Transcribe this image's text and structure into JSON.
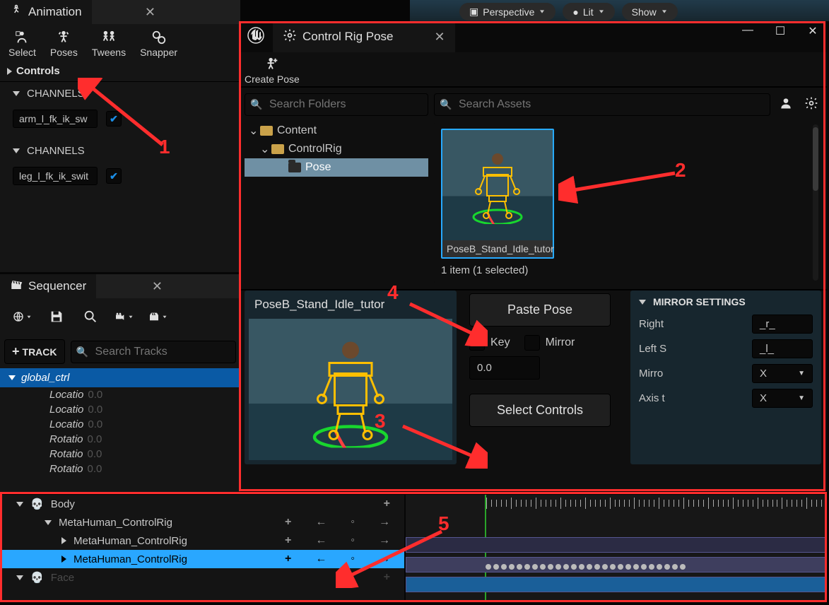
{
  "animation": {
    "title": "Animation",
    "tools": {
      "select": "Select",
      "poses": "Poses",
      "tweens": "Tweens",
      "snapper": "Snapper"
    },
    "controls_section": "Controls",
    "channels_label": "CHANNELS",
    "channel1_name": "arm_l_fk_ik_sw",
    "channel2_name": "leg_l_fk_ik_swit"
  },
  "sequencer": {
    "title": "Sequencer",
    "add_track": "TRACK",
    "search_placeholder": "Search Tracks",
    "global_ctrl": "global_ctrl",
    "props": [
      {
        "label": "Locatio",
        "value": "0.0"
      },
      {
        "label": "Locatio",
        "value": "0.0"
      },
      {
        "label": "Locatio",
        "value": "0.0"
      },
      {
        "label": "Rotatio",
        "value": "0.0"
      },
      {
        "label": "Rotatio",
        "value": "0.0"
      },
      {
        "label": "Rotatio",
        "value": "0.0"
      }
    ],
    "body_track": "Body",
    "rig_tracks": [
      "MetaHuman_ControlRig",
      "MetaHuman_ControlRig",
      "MetaHuman_ControlRig"
    ],
    "last_track_partial": "Face"
  },
  "viewport": {
    "perspective": "Perspective",
    "lit": "Lit",
    "show": "Show"
  },
  "control_rig_pose": {
    "title": "Control Rig Pose",
    "create_pose": "Create Pose",
    "search_folders_ph": "Search Folders",
    "search_assets_ph": "Search Assets",
    "tree": {
      "content": "Content",
      "control_rig": "ControlRig",
      "pose": "Pose"
    },
    "asset_name": "PoseB_Stand_Idle_tutor",
    "status": "1 item (1 selected)",
    "preview_title": "PoseB_Stand_Idle_tutor",
    "paste_pose": "Paste Pose",
    "key_label": "Key",
    "mirror_label": "Mirror",
    "blend_value": "0.0",
    "select_controls": "Select Controls",
    "mirror_settings": {
      "title": "MIRROR SETTINGS",
      "right_label": "Right",
      "right_val": "_r_",
      "left_label": "Left S",
      "left_val": "_l_",
      "mirror_axis_label": "Mirro",
      "mirror_axis_val": "X",
      "axis_flip_label": "Axis t",
      "axis_flip_val": "X"
    }
  },
  "annotations": {
    "n1": "1",
    "n2": "2",
    "n3": "3",
    "n4": "4",
    "n5": "5"
  }
}
